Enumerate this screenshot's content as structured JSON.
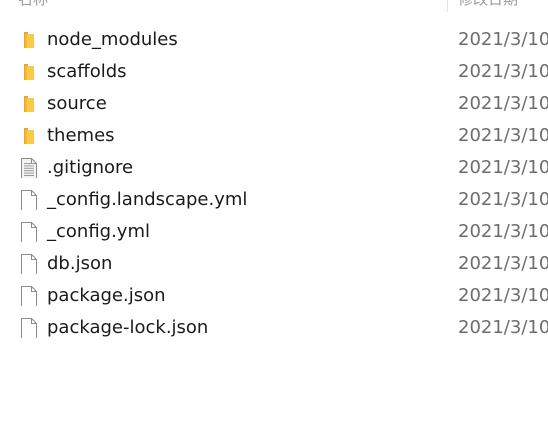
{
  "header": {
    "name_label": "名称",
    "date_label": "修改日期"
  },
  "files": [
    {
      "name": "node_modules",
      "type": "folder",
      "icon": "folder-icon",
      "date": "2021/3/10"
    },
    {
      "name": "scaffolds",
      "type": "folder",
      "icon": "folder-icon",
      "date": "2021/3/10"
    },
    {
      "name": "source",
      "type": "folder",
      "icon": "folder-icon",
      "date": "2021/3/10"
    },
    {
      "name": "themes",
      "type": "folder",
      "icon": "folder-icon",
      "date": "2021/3/10"
    },
    {
      "name": ".gitignore",
      "type": "text",
      "icon": "text-file-icon",
      "date": "2021/3/10"
    },
    {
      "name": "_config.landscape.yml",
      "type": "file",
      "icon": "file-icon",
      "date": "2021/3/10"
    },
    {
      "name": "_config.yml",
      "type": "file",
      "icon": "file-icon",
      "date": "2021/3/10"
    },
    {
      "name": "db.json",
      "type": "file",
      "icon": "file-icon",
      "date": "2021/3/10"
    },
    {
      "name": "package.json",
      "type": "file",
      "icon": "file-icon",
      "date": "2021/3/10"
    },
    {
      "name": "package-lock.json",
      "type": "file",
      "icon": "file-icon",
      "date": "2021/3/10"
    }
  ],
  "colors": {
    "folder": "#f8c94a",
    "folder_dark": "#e6a821",
    "file_border": "#8a8a8a"
  }
}
